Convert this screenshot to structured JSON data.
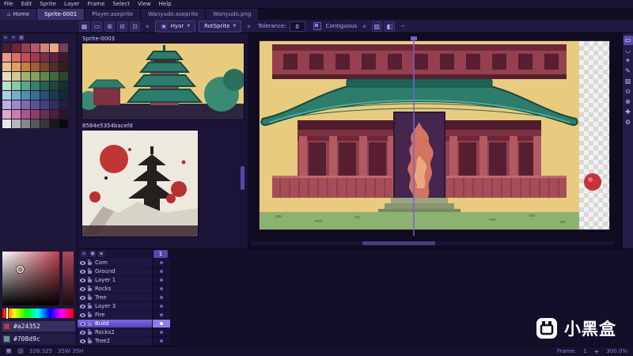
{
  "theme": {
    "background": "#0f0b1d",
    "panel": "#1e1739",
    "accent": "#5a48a8",
    "selection": "#7d69e2",
    "text": "#cfc6ee",
    "status_text": "#8d7ce0"
  },
  "menu": {
    "items": [
      "File",
      "Edit",
      "Sprite",
      "Layer",
      "Frame",
      "Select",
      "View",
      "Help"
    ]
  },
  "tabs": {
    "home_label": "Home",
    "items": [
      {
        "label": "Sprite-0001",
        "active": true
      },
      {
        "label": "Player.aseprite",
        "active": false
      },
      {
        "label": "Wanyudo.aseprite",
        "active": false
      },
      {
        "label": "Wanyudo.png",
        "active": false
      }
    ]
  },
  "toolbar": {
    "select_icons": [
      {
        "name": "grid-icon",
        "glyph": "▦"
      },
      {
        "name": "replace-selection-icon",
        "glyph": "▭"
      },
      {
        "name": "add-selection-icon",
        "glyph": "⊞"
      },
      {
        "name": "subtract-selection-icon",
        "glyph": "⊟"
      },
      {
        "name": "intersect-selection-icon",
        "glyph": "⊡"
      }
    ],
    "blend_value": "Hyar",
    "rotation_value": "RotSprite",
    "tolerance_label": "Tolerance:",
    "tolerance_value": "0",
    "contiguous_label": "Contiguous",
    "extra_icons": [
      {
        "name": "pixel-perfect-icon",
        "glyph": "▨"
      },
      {
        "name": "trim-icon",
        "glyph": "◧"
      }
    ],
    "minus_glyph": "–"
  },
  "previews": {
    "title1": "Sprite-0003",
    "title2": "8584e5354bacefd"
  },
  "palette": {
    "rows": [
      [
        "#4a1f2e",
        "#6e2738",
        "#96404f",
        "#b55a62",
        "#d18472",
        "#e8a886",
        "#774052"
      ],
      [
        "#e89a8a",
        "#d87060",
        "#c25050",
        "#a23b48",
        "#7c2f40",
        "#5a2436",
        "#3c1a2a"
      ],
      [
        "#f0c08a",
        "#e0a060",
        "#c88040",
        "#a06030",
        "#784828",
        "#503020",
        "#302018"
      ],
      [
        "#e8e0b8",
        "#d0c890",
        "#a8b070",
        "#88a058",
        "#5f8848",
        "#3f6838",
        "#2a4830"
      ],
      [
        "#b8e0c8",
        "#88c8a8",
        "#58a888",
        "#388068",
        "#286050",
        "#1c4840",
        "#143028"
      ],
      [
        "#a8d0e0",
        "#78b0c8",
        "#5090b0",
        "#387090",
        "#285070",
        "#1c3850",
        "#142838"
      ],
      [
        "#c0b0e0",
        "#a088c8",
        "#8068b0",
        "#605090",
        "#484078",
        "#303058",
        "#202040"
      ],
      [
        "#e0a8c8",
        "#c880a8",
        "#a85888",
        "#884068",
        "#683050",
        "#482038",
        "#2a1428"
      ],
      [
        "#e8e8e8",
        "#b8b8b8",
        "#888888",
        "#585858",
        "#383838",
        "#181818",
        "#0a0a0a"
      ]
    ]
  },
  "colors": {
    "foreground_hex": "#a24352",
    "background_hex": "#708d9c"
  },
  "layers": {
    "frame_header": "1",
    "items": [
      {
        "name": "Com",
        "selected": false
      },
      {
        "name": "Ground",
        "selected": false
      },
      {
        "name": "Layer 1",
        "selected": false
      },
      {
        "name": "Rocks",
        "selected": false
      },
      {
        "name": "Tree",
        "selected": false
      },
      {
        "name": "Layer 3",
        "selected": false
      },
      {
        "name": "Fire",
        "selected": false
      },
      {
        "name": "Build",
        "selected": true
      },
      {
        "name": "Rocks2",
        "selected": false
      },
      {
        "name": "Tree2",
        "selected": false
      }
    ]
  },
  "tools": [
    {
      "name": "rect-marquee-tool-icon",
      "glyph": "▭"
    },
    {
      "name": "lasso-tool-icon",
      "glyph": "◡"
    },
    {
      "name": "magic-wand-tool-icon",
      "glyph": "✶"
    },
    {
      "name": "pencil-tool-icon",
      "glyph": "✎"
    },
    {
      "name": "spray-tool-icon",
      "glyph": "▧"
    },
    {
      "name": "eyedropper-tool-icon",
      "glyph": "⊙"
    },
    {
      "name": "zoom-tool-icon",
      "glyph": "⊕"
    },
    {
      "name": "move-tool-icon",
      "glyph": "✚"
    },
    {
      "name": "settings-tool-icon",
      "glyph": "⚙"
    }
  ],
  "statusbar": {
    "position": "326:325",
    "size": "35W 35H",
    "frame_label": "Frame:",
    "frame_value": "1",
    "plus": "+",
    "zoom": "300.0%"
  },
  "watermark": {
    "text": "小黑盒"
  },
  "art_colors": {
    "sky_cream": "#e9cb80",
    "roof_teal": "#2d7c6c",
    "wall_red": "#94404f",
    "portal_purple": "#46254e",
    "flame_orange": "#d2745f",
    "grass_green": "#8cb272",
    "ball_red": "#c5333d"
  }
}
